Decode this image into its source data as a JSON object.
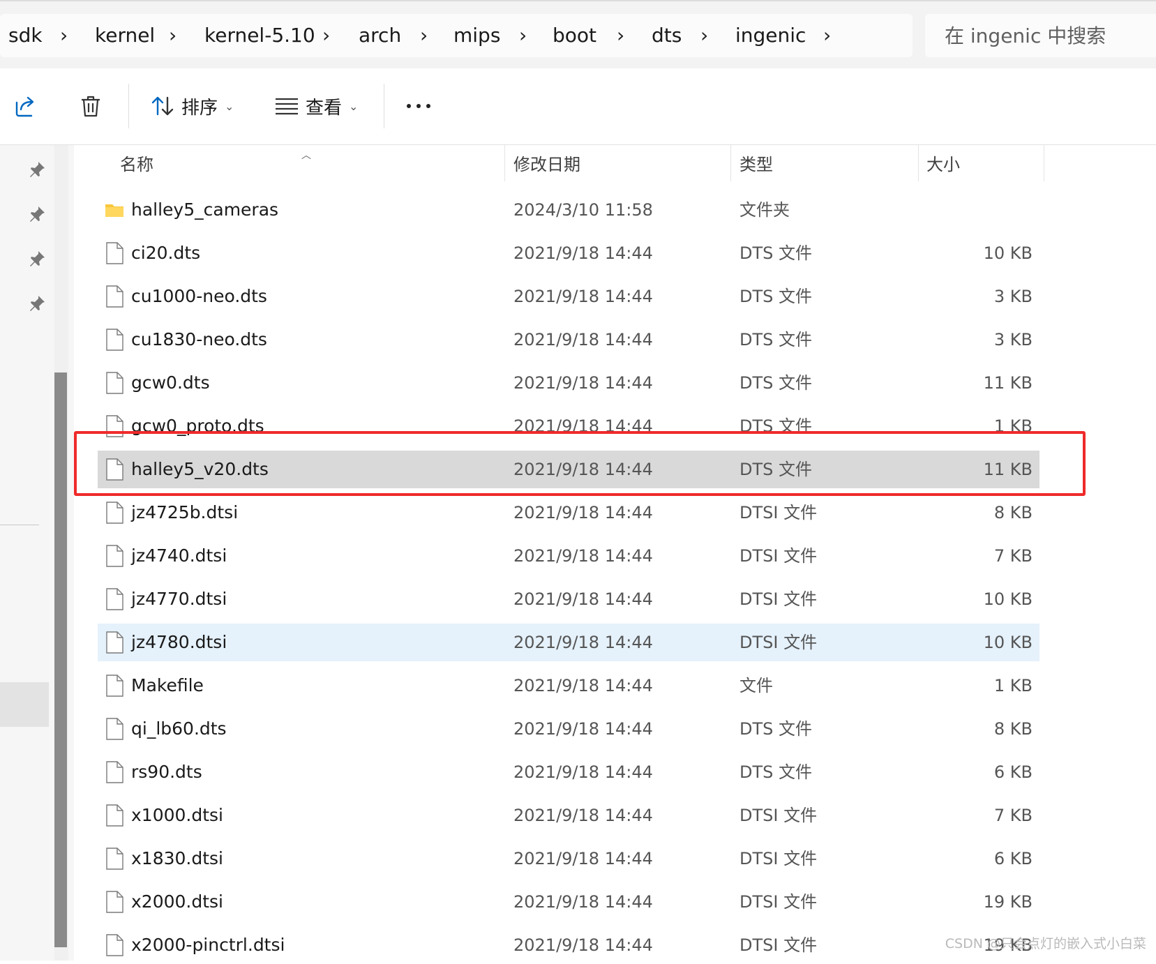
{
  "breadcrumb": [
    "sdk",
    "kernel",
    "kernel-5.10",
    "arch",
    "mips",
    "boot",
    "dts",
    "ingenic"
  ],
  "search": {
    "placeholder": "在 ingenic 中搜索"
  },
  "toolbar": {
    "share_icon": "share-icon",
    "delete_icon": "trash-icon",
    "sort_label": "排序",
    "view_label": "查看",
    "more_label": "···"
  },
  "columns": {
    "name": "名称",
    "date": "修改日期",
    "type": "类型",
    "size": "大小"
  },
  "files": [
    {
      "name": "halley5_cameras",
      "date": "2024/3/10 11:58",
      "type": "文件夹",
      "size": "",
      "icon": "folder-icon"
    },
    {
      "name": "ci20.dts",
      "date": "2021/9/18 14:44",
      "type": "DTS 文件",
      "size": "10 KB",
      "icon": "file-icon"
    },
    {
      "name": "cu1000-neo.dts",
      "date": "2021/9/18 14:44",
      "type": "DTS 文件",
      "size": "3 KB",
      "icon": "file-icon"
    },
    {
      "name": "cu1830-neo.dts",
      "date": "2021/9/18 14:44",
      "type": "DTS 文件",
      "size": "3 KB",
      "icon": "file-icon"
    },
    {
      "name": "gcw0.dts",
      "date": "2021/9/18 14:44",
      "type": "DTS 文件",
      "size": "11 KB",
      "icon": "file-icon"
    },
    {
      "name": "gcw0_proto.dts",
      "date": "2021/9/18 14:44",
      "type": "DTS 文件",
      "size": "1 KB",
      "icon": "file-icon"
    },
    {
      "name": "halley5_v20.dts",
      "date": "2021/9/18 14:44",
      "type": "DTS 文件",
      "size": "11 KB",
      "icon": "file-icon",
      "state": "selected"
    },
    {
      "name": "jz4725b.dtsi",
      "date": "2021/9/18 14:44",
      "type": "DTSI 文件",
      "size": "8 KB",
      "icon": "file-icon"
    },
    {
      "name": "jz4740.dtsi",
      "date": "2021/9/18 14:44",
      "type": "DTSI 文件",
      "size": "7 KB",
      "icon": "file-icon"
    },
    {
      "name": "jz4770.dtsi",
      "date": "2021/9/18 14:44",
      "type": "DTSI 文件",
      "size": "10 KB",
      "icon": "file-icon"
    },
    {
      "name": "jz4780.dtsi",
      "date": "2021/9/18 14:44",
      "type": "DTSI 文件",
      "size": "10 KB",
      "icon": "file-icon",
      "state": "hover"
    },
    {
      "name": "Makefile",
      "date": "2021/9/18 14:44",
      "type": "文件",
      "size": "1 KB",
      "icon": "file-icon"
    },
    {
      "name": "qi_lb60.dts",
      "date": "2021/9/18 14:44",
      "type": "DTS 文件",
      "size": "8 KB",
      "icon": "file-icon"
    },
    {
      "name": "rs90.dts",
      "date": "2021/9/18 14:44",
      "type": "DTS 文件",
      "size": "6 KB",
      "icon": "file-icon"
    },
    {
      "name": "x1000.dtsi",
      "date": "2021/9/18 14:44",
      "type": "DTSI 文件",
      "size": "7 KB",
      "icon": "file-icon"
    },
    {
      "name": "x1830.dtsi",
      "date": "2021/9/18 14:44",
      "type": "DTSI 文件",
      "size": "6 KB",
      "icon": "file-icon"
    },
    {
      "name": "x2000.dtsi",
      "date": "2021/9/18 14:44",
      "type": "DTSI 文件",
      "size": "19 KB",
      "icon": "file-icon"
    },
    {
      "name": "x2000-pinctrl.dtsi",
      "date": "2021/9/18 14:44",
      "type": "DTSI 文件",
      "size": "19 KB",
      "icon": "file-icon"
    }
  ],
  "watermark": "CSDN @只会点灯的嵌入式小白菜",
  "colors": {
    "selected_row": "#d9d9d9",
    "hover_row": "#e5f1fb",
    "annotation_box": "#ef2a2a",
    "accent": "#0067c0"
  }
}
